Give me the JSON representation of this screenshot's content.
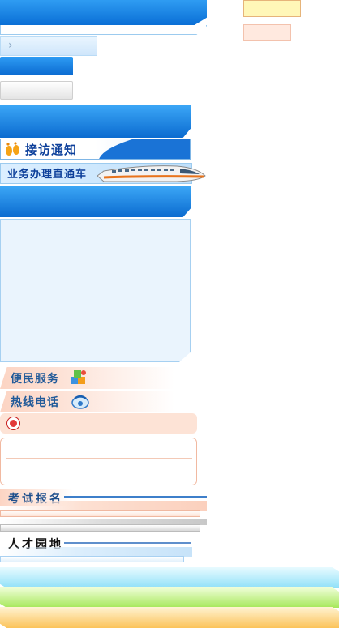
{
  "chevron_glyph": "›",
  "banners": {
    "interview_notice": "接访通知",
    "business_express": "业务办理直通车"
  },
  "sections": {
    "convenience_services": "便民服务",
    "hotline": "热线电话",
    "exam_registration": "考试报名",
    "talent_garden": "人才园地"
  },
  "icons": {
    "footsteps": "footsteps-icon",
    "train": "high-speed-train-icon",
    "puzzle": "puzzle-icon",
    "phone": "phone-icon",
    "record": "record-icon"
  },
  "colors": {
    "primary_blue": "#0a6fd6",
    "peach": "#fde3d6",
    "text_blue": "#215a99"
  }
}
